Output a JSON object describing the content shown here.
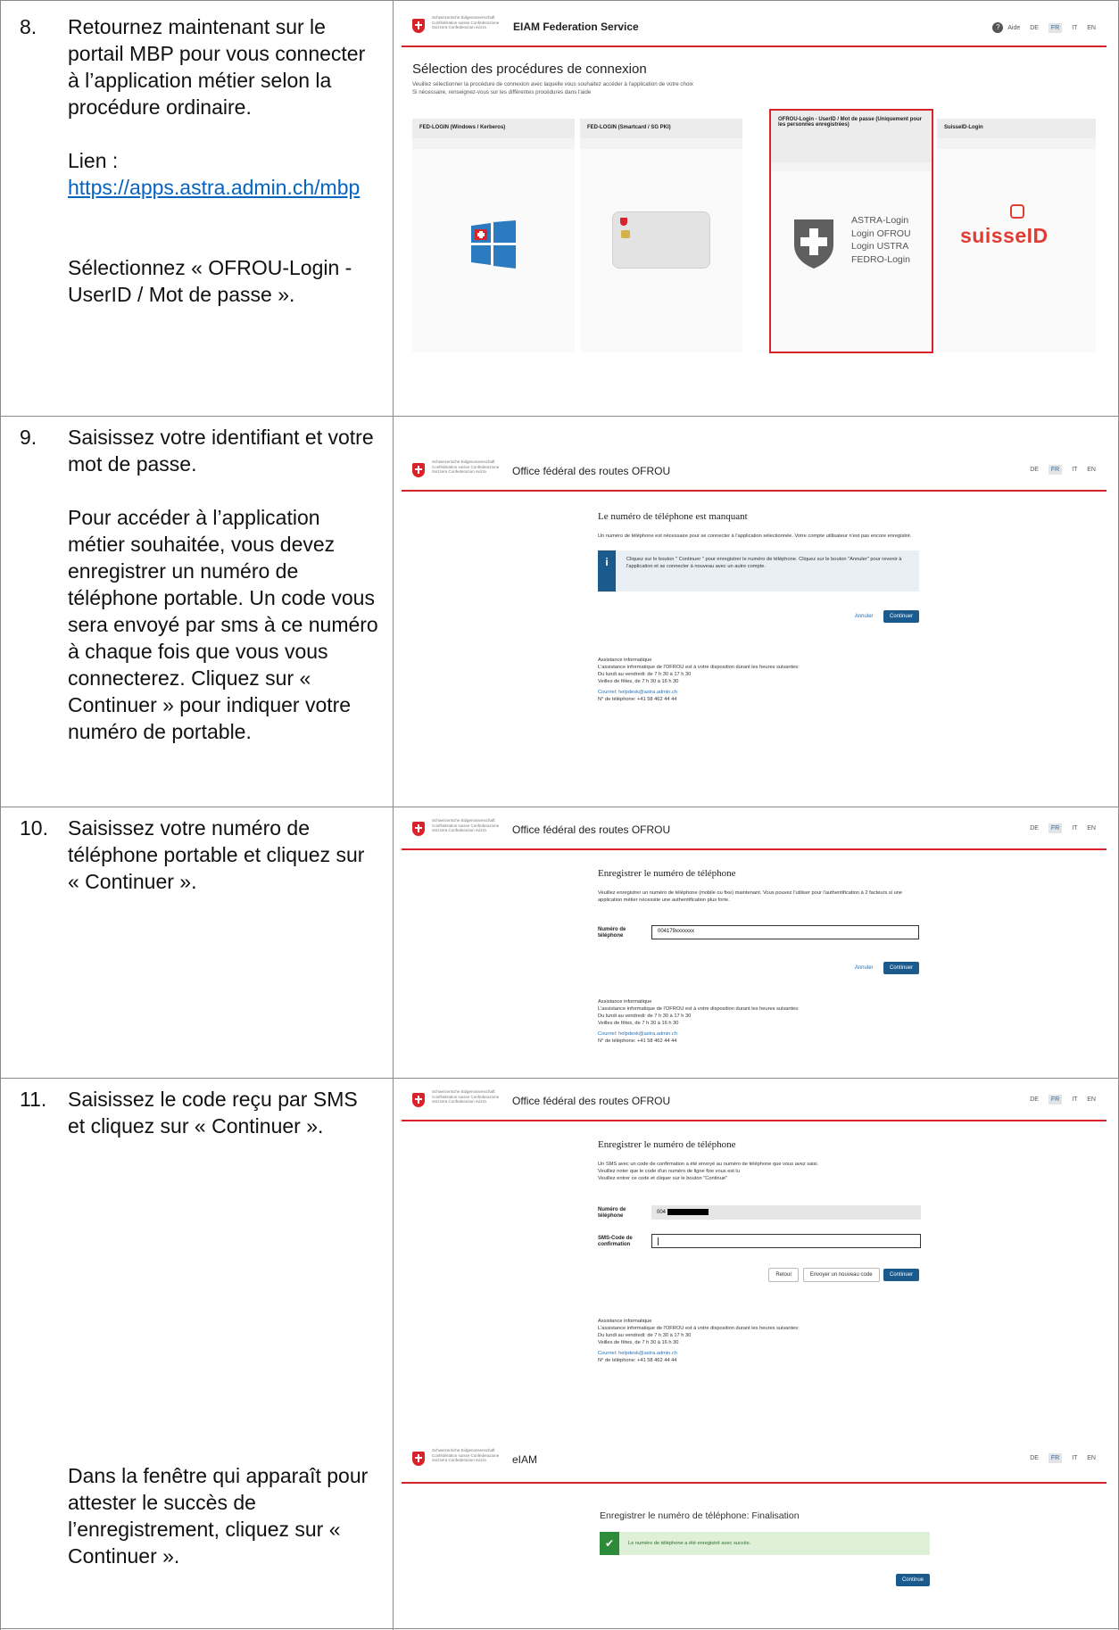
{
  "steps": [
    {
      "number": "8.",
      "lines": [
        "Retournez maintenant sur le portail MBP pour vous connecter à l’application métier selon la procédure ordinaire."
      ],
      "link_label": "Lien :",
      "link_url": "https://apps.astra.admin.ch/mbp",
      "instruction": "Sélectionnez « OFROU-Login - UserID / Mot de passe »."
    },
    {
      "number": "9.",
      "text1": "Saisissez votre identifiant et votre mot de passe.",
      "text2": "Pour accéder à l’application métier souhaitée, vous devez enregistrer un numéro de téléphone portable. Un code vous sera envoyé par sms à ce numéro à chaque fois que vous vous connecterez. Cliquez sur « Continuer » pour indiquer votre numéro de portable."
    },
    {
      "number": "10.",
      "text1": "Saisissez votre numéro de téléphone portable et cliquez sur « Continuer »."
    },
    {
      "number": "11.",
      "text1": "Saisissez le code reçu par SMS et cliquez sur « Continuer ».",
      "text2": "Dans la fenêtre qui apparaît pour attester le succès de l’enregistrement, cliquez sur « Continuer »."
    }
  ],
  "confederation": "Schweizerische Eidgenossenschaft Confédération suisse Confederazione Svizzera Confederaziun svizra",
  "langs": [
    "DE",
    "FR",
    "IT",
    "EN"
  ],
  "shot1": {
    "title": "EIAM Federation Service",
    "help": "Aide",
    "heading": "Sélection des procédures de connexion",
    "sub1": "Veuillez sélectionner la procédure de connexion avec laquelle vous souhaitez accéder à l'application de votre choix",
    "sub2": "Si nécessaire, renseignez-vous sur les différentes procédures dans l'aide",
    "cards": [
      "FED-LOGIN (Windows / Kerberos)",
      "FED-LOGIN (Smartcard / SG PKI)",
      "OFROU-Login - UserID / Mot de passe (Uniquement pour les personnes enregistrées)",
      "SuisseID-Login"
    ],
    "astra_lines": [
      "ASTRA-Login",
      "Login OFROU",
      "Login USTRA",
      "FEDRO-Login"
    ],
    "suisseid": "suisseID"
  },
  "office": "Office fédéral des routes OFROU",
  "shot2": {
    "heading": "Le numéro de téléphone est manquant",
    "para": "Un numéro de téléphone est nécessaire pour se connecter à l'application sélectionnée. Votre compte utilisateur n'est pas encore enregistré.",
    "info": "Cliquez sur le bouton \" Continuer \" pour enregistrer le numéro de téléphone. Cliquez sur le bouton \"Annuler\" pour revenir à l'application et se connecter à nouveau avec un autre compte.",
    "cancel": "Annuler",
    "continue": "Continuer"
  },
  "support": {
    "title": "Assistance informatique",
    "line1": "L'assistance informatique de l'OFROU est à votre disposition durant les heures suivantes:",
    "line2": "Du lundi au vendredi: de 7 h 30 à 17 h 30",
    "line3": "Veilles de fêtes, de 7 h 30 à 16 h 30",
    "mail": "Courriel: helpdesk@astra.admin.ch",
    "phone": "N° de téléphone: +41 58 462 44 44"
  },
  "shot3": {
    "heading": "Enregistrer le numéro de téléphone",
    "para": "Veuillez enregistrer un numéro de téléphone (mobile ou fixe) maintenant. Vous pouvez l'utiliser pour l'authentification à 2 facteurs si une application métier nécessite une authentification plus forte.",
    "label": "Numéro de téléphone",
    "value": "004179xxxxxxx",
    "cancel": "Annuler",
    "continue": "Continuer"
  },
  "shot4": {
    "heading": "Enregistrer le numéro de téléphone",
    "para1": "Un SMS avec un code de confirmation a été envoyé au numéro de téléphone que vous avez saisi.",
    "para2": "Veuillez noter que le code d'un numéro de ligne fixe vous est lu",
    "para3": "Veuillez entrer ce code et cliquer sur le bouton \"Continue\"",
    "label_phone": "Numéro de téléphone",
    "phone_prefix": "004",
    "label_code": "SMS-Code de confirmation",
    "back": "Retour",
    "resend": "Envoyer un nouveau code",
    "continue": "Continuer"
  },
  "shot5": {
    "title": "eIAM",
    "heading": "Enregistrer le numéro de téléphone: Finalisation",
    "success": "Le numéro de téléphone a été enregistré avec succès.",
    "continue": "Continue"
  },
  "colors": {
    "red": "#d8232a",
    "blue": "#1b5a8c",
    "link": "#0563c1",
    "success": "#dff0d8",
    "check": "#2e8b3a"
  }
}
